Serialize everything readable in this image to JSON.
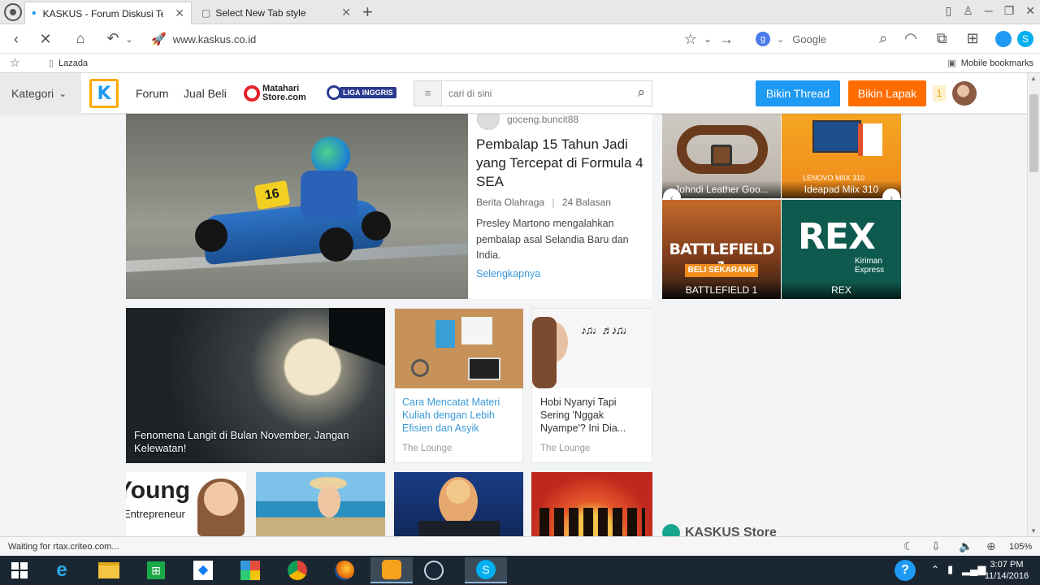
{
  "browser": {
    "tabs": [
      {
        "title": "KASKUS - Forum Diskusi Terb"
      },
      {
        "title": "Select New Tab style"
      }
    ],
    "url": "www.kaskus.co.id",
    "search_engine": "Google",
    "bookmarks": [
      "Lazada"
    ],
    "mobile_bookmarks": "Mobile bookmarks",
    "status": "Waiting for rtax.criteo.com...",
    "zoom": "105%"
  },
  "site": {
    "category_label": "Kategori",
    "nav": [
      "Forum",
      "Jual Beli"
    ],
    "matahari": {
      "line1": "Matahari",
      "line2": "Store.com"
    },
    "liga": "LIGA INGGRIS",
    "search_placeholder": "cari di sini",
    "btn_thread": "Bikin Thread",
    "btn_lapak": "Bikin Lapak",
    "notif_count": "1",
    "colors": {
      "blue": "#1e9af2",
      "orange": "#ff6d00",
      "link": "#3a99d8"
    }
  },
  "featured": {
    "author": "goceng.buncit88",
    "title": "Pembalap 15 Tahun Jadi yang Tercepat di Formula 4 SEA",
    "category": "Berita Olahraga",
    "replies": "24 Balasan",
    "excerpt": "Presley Martono mengalahkan pembalap asal Selandia Baru dan India.",
    "more": "Selengkapnya",
    "kart_number": "16"
  },
  "store_ads": [
    {
      "caption": "Johndi Leather Goo..."
    },
    {
      "caption": "Ideapad Miix 310",
      "sub": "LENOVO MIIX 310"
    },
    {
      "caption": "BATTLEFIELD 1",
      "logo": "BATTLEFIELD 1",
      "cta": "BELI SEKARANG"
    },
    {
      "caption": "REX",
      "logo": "REX",
      "sub1": "Kiriman",
      "sub2": "Express"
    }
  ],
  "grid": {
    "moon": {
      "title": "Fenomena Langit di Bulan November, Jangan Kelewatan!"
    },
    "cards": [
      {
        "title": "Cara Mencatat Materi Kuliah dengan Lebih Efisien dan Asyik",
        "category": "The Lounge"
      },
      {
        "title": "Hobi Nyanyi Tapi Sering 'Nggak Nyampe'? Ini Dia...",
        "category": "The Lounge"
      }
    ],
    "young": {
      "line1": "Young",
      "line2": "Entrepreneur"
    },
    "kaskus_store": "KASKUS Store"
  },
  "taskbar": {
    "time": "3:07 PM",
    "date": "11/14/2016"
  }
}
